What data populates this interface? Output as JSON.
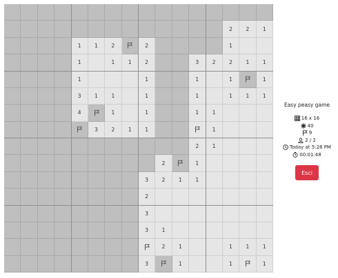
{
  "board": {
    "size": 16,
    "rows": [
      [
        "H",
        "H",
        "H",
        "H",
        "H",
        "H",
        "H",
        "H",
        "H",
        "H",
        "H",
        "H",
        "H",
        "H",
        "H",
        "H"
      ],
      [
        "H",
        "H",
        "H",
        "H",
        "H",
        "H",
        "H",
        "H",
        "H",
        "H",
        "H",
        "H",
        "H",
        "2",
        "2",
        "1"
      ],
      [
        "H",
        "H",
        "H",
        "H",
        "1",
        "1",
        "2",
        "F",
        "2",
        "H",
        "H",
        "H",
        "H",
        "1",
        "",
        ""
      ],
      [
        "H",
        "H",
        "H",
        "H",
        "1",
        "",
        "1",
        "1",
        "2",
        "H",
        "H",
        "3",
        "2",
        "2",
        "1",
        "1"
      ],
      [
        "H",
        "H",
        "H",
        "H",
        "1",
        "",
        "",
        "",
        "1",
        "H",
        "H",
        "1",
        "",
        "1",
        "F",
        "1"
      ],
      [
        "H",
        "H",
        "H",
        "H",
        "3",
        "1",
        "1",
        "",
        "1",
        "H",
        "H",
        "1",
        "",
        "1",
        "1",
        "1"
      ],
      [
        "H",
        "H",
        "H",
        "H",
        "4",
        "F",
        "1",
        "",
        "1",
        "H",
        "H",
        "1",
        "1",
        "",
        "",
        ""
      ],
      [
        "H",
        "H",
        "H",
        "H",
        "F",
        "3",
        "2",
        "1",
        "1",
        "H",
        "H",
        "F",
        "1",
        "",
        "",
        ""
      ],
      [
        "H",
        "H",
        "H",
        "H",
        "H",
        "H",
        "H",
        "H",
        "H",
        "H",
        "H",
        "2",
        "1",
        "",
        "",
        ""
      ],
      [
        "H",
        "H",
        "H",
        "H",
        "H",
        "H",
        "H",
        "H",
        "H",
        "2",
        "F",
        "1",
        "",
        "",
        "",
        ""
      ],
      [
        "H",
        "H",
        "H",
        "H",
        "H",
        "H",
        "H",
        "H",
        "3",
        "2",
        "1",
        "1",
        "",
        "",
        "",
        ""
      ],
      [
        "H",
        "H",
        "H",
        "H",
        "H",
        "H",
        "H",
        "H",
        "2",
        "",
        "",
        "",
        "",
        "",
        "",
        ""
      ],
      [
        "H",
        "H",
        "H",
        "H",
        "H",
        "H",
        "H",
        "H",
        "3",
        "",
        "",
        "",
        "",
        "",
        "",
        ""
      ],
      [
        "H",
        "H",
        "H",
        "H",
        "H",
        "H",
        "H",
        "H",
        "3",
        "1",
        "",
        "",
        "",
        "",
        "",
        ""
      ],
      [
        "H",
        "H",
        "H",
        "H",
        "H",
        "H",
        "H",
        "H",
        "F",
        "2",
        "1",
        "",
        "",
        "1",
        "1",
        "1"
      ],
      [
        "H",
        "H",
        "H",
        "H",
        "H",
        "H",
        "H",
        "H",
        "3",
        "F",
        "1",
        "",
        "",
        "1",
        "F",
        "1"
      ]
    ],
    "open_flags": [
      [
        7,
        11
      ],
      [
        14,
        8
      ],
      [
        15,
        14
      ]
    ]
  },
  "sidebar": {
    "title": "Easy peasy game",
    "size_label": "16 x 16",
    "mines": "40",
    "flags": "9",
    "players": "2 / 2",
    "started": "Today at 5:28 PM",
    "timer": "00:01:48",
    "exit_label": "Esci"
  },
  "colors": {
    "hidden": "#bfbfbf",
    "open": "#e6e6e6",
    "exit_button": "#dc3545"
  }
}
